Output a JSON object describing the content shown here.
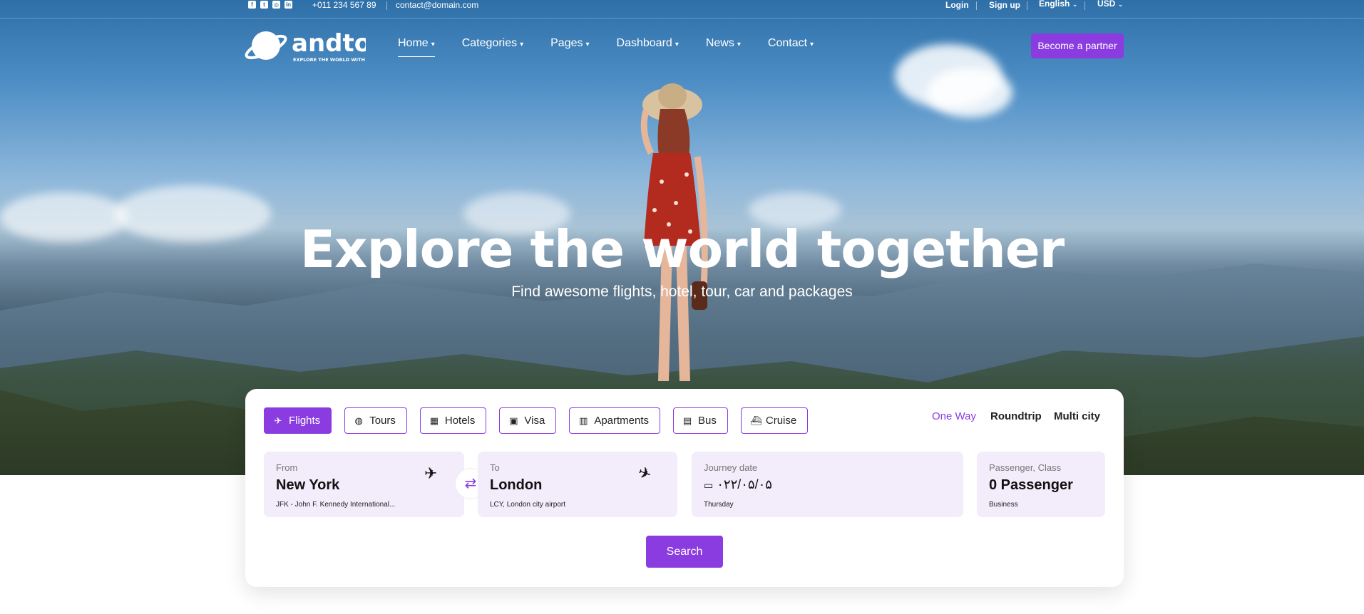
{
  "topbar": {
    "phone": "+011 234 567 89",
    "email": "contact@domain.com",
    "login": "Login",
    "signup": "Sign up",
    "language": "English",
    "currency": "USD",
    "social_icons": [
      "facebook-icon",
      "twitter-icon",
      "instagram-icon",
      "linkedin-icon"
    ]
  },
  "brand": {
    "name": "andtour",
    "tagline": "EXPLORE THE WORLD WITH US"
  },
  "nav": {
    "items": [
      {
        "label": "Home"
      },
      {
        "label": "Categories"
      },
      {
        "label": "Pages"
      },
      {
        "label": "Dashboard"
      },
      {
        "label": "News"
      },
      {
        "label": "Contact"
      }
    ],
    "cta": "Become a partner"
  },
  "hero": {
    "title": "Explore the world together",
    "subtitle": "Find awesome flights, hotel, tour, car and packages"
  },
  "search": {
    "tabs": [
      {
        "label": "Flights",
        "icon": "plane-icon"
      },
      {
        "label": "Tours",
        "icon": "globe-icon"
      },
      {
        "label": "Hotels",
        "icon": "building-icon"
      },
      {
        "label": "Visa",
        "icon": "passport-icon"
      },
      {
        "label": "Apartments",
        "icon": "apartment-icon"
      },
      {
        "label": "Bus",
        "icon": "bus-icon"
      },
      {
        "label": "Cruise",
        "icon": "ship-icon"
      }
    ],
    "trip_types": [
      "One Way",
      "Roundtrip",
      "Multi city"
    ],
    "from": {
      "label": "From",
      "value": "New York",
      "sub": "JFK - John F. Kennedy International..."
    },
    "to": {
      "label": "To",
      "value": "London",
      "sub": "LCY, London city airport"
    },
    "date": {
      "label": "Journey date",
      "value": "۰۲۲/۰۵/۰۵",
      "sub": "Thursday"
    },
    "passenger": {
      "label": "Passenger, Class",
      "value": "0 Passenger",
      "sub": "Business"
    },
    "button": "Search"
  },
  "colors": {
    "accent": "#8a3ce0",
    "field_bg": "#f2ecfb"
  }
}
